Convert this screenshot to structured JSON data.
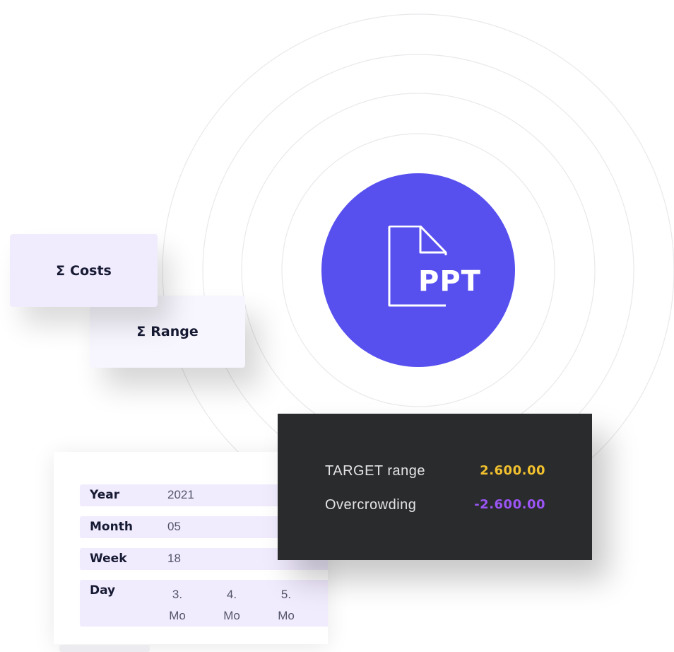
{
  "colors": {
    "accent": "#5750ee",
    "dark_panel": "#2a2b2d",
    "card_light": "#f1ebfe",
    "target_value": "#f2c12e",
    "overcrowding_value": "#9b55f5"
  },
  "ppt_badge": {
    "icon": "document-icon",
    "label": "PPT"
  },
  "cards": {
    "costs": {
      "symbol": "Σ",
      "label": "Costs"
    },
    "range": {
      "symbol": "Σ",
      "label": "Range"
    }
  },
  "date_table": {
    "year": {
      "label": "Year",
      "value": "2021"
    },
    "month": {
      "label": "Month",
      "value": "05"
    },
    "week": {
      "label": "Week",
      "value": "18"
    },
    "day": {
      "label": "Day",
      "days": [
        {
          "num": "3.",
          "weekday": "Mo"
        },
        {
          "num": "4.",
          "weekday": "Mo"
        },
        {
          "num": "5.",
          "weekday": "Mo"
        }
      ]
    }
  },
  "stats": {
    "target": {
      "label": "TARGET range",
      "value": "2.600.00"
    },
    "overcrowding": {
      "label": "Overcrowding",
      "value": "-2.600.00"
    }
  }
}
